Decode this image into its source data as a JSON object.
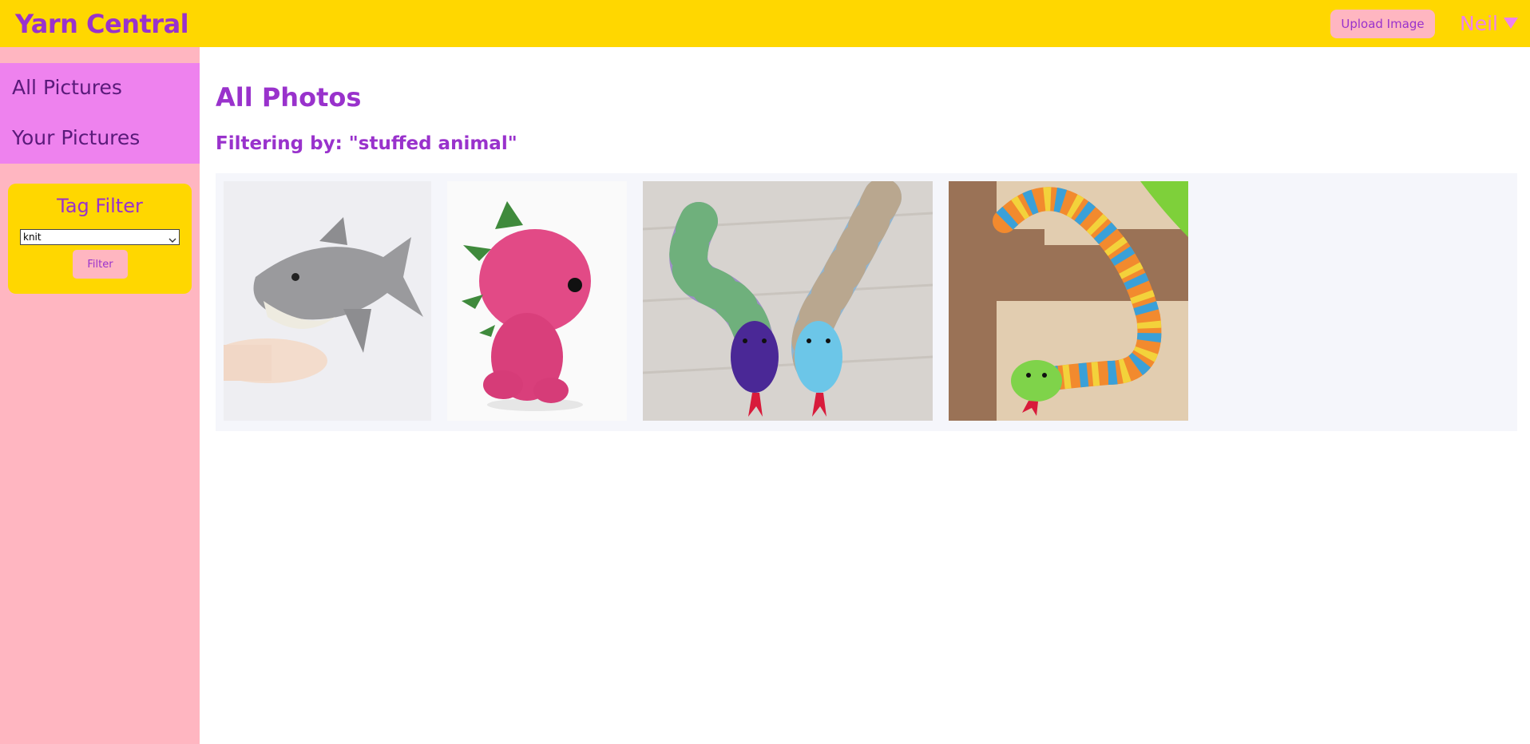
{
  "header": {
    "brand": "Yarn Central",
    "upload_label": "Upload Image",
    "user_name": "Neil",
    "caret_icon": "caret-down-icon"
  },
  "sidebar": {
    "items": [
      {
        "label": "All Pictures"
      },
      {
        "label": "Your Pictures"
      }
    ],
    "tag_filter": {
      "title": "Tag Filter",
      "selected": "knit",
      "button_label": "Filter"
    }
  },
  "main": {
    "title": "All Photos",
    "filter_text": "Filtering by: \"stuffed animal\"",
    "photos": [
      {
        "subject": "crocheted gray shark held in hand"
      },
      {
        "subject": "pink crocheted dinosaur with green spikes"
      },
      {
        "subject": "two crocheted striped snakes, purple and blue"
      },
      {
        "subject": "rainbow striped knitted snake on blanket"
      }
    ]
  },
  "colors": {
    "header_bg": "#ffd700",
    "brand": "#9932cc",
    "sidebar_bg": "#ffb6c1",
    "nav_bg": "#ee82ee",
    "button_bg": "#ffb6c1"
  }
}
